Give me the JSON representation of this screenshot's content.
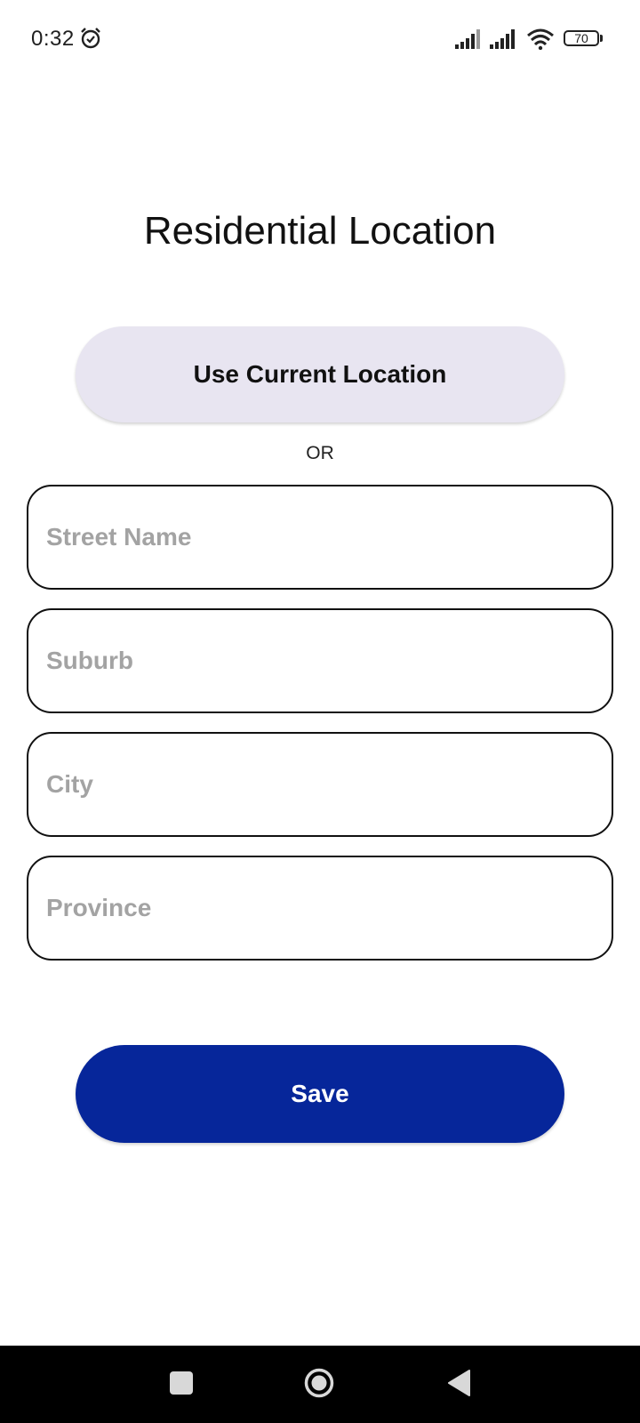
{
  "status_bar": {
    "time": "0:32",
    "battery": "70",
    "icons": [
      "alarm-icon",
      "signal-icon",
      "signal-icon",
      "wifi-icon",
      "battery-icon"
    ]
  },
  "page": {
    "title": "Residential Location"
  },
  "location": {
    "use_current_label": "Use Current Location",
    "or_label": "OR"
  },
  "form": {
    "street": {
      "placeholder": "Street Name",
      "value": ""
    },
    "suburb": {
      "placeholder": "Suburb",
      "value": ""
    },
    "city": {
      "placeholder": "City",
      "value": ""
    },
    "province": {
      "placeholder": "Province",
      "value": ""
    },
    "save_label": "Save"
  },
  "nav_bar": {
    "icons": [
      "recents-icon",
      "home-icon",
      "back-icon"
    ]
  },
  "colors": {
    "primary": "#06269a",
    "secondary_button": "#e8e5f1",
    "placeholder": "#a3a3a3"
  }
}
